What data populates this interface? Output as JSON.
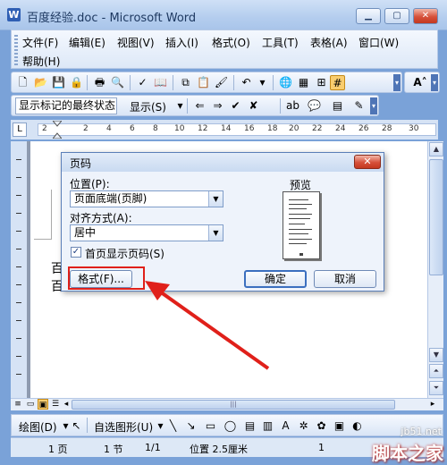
{
  "window": {
    "title": "百度经验.doc - Microsoft Word",
    "buttons": {
      "minimize": "▁",
      "maximize": "▢",
      "close": "✕"
    }
  },
  "menu": {
    "row1": [
      "文件(F)",
      "编辑(E)",
      "视图(V)",
      "插入(I)",
      "格式(O)",
      "工具(T)",
      "表格(A)",
      "窗口(W)"
    ],
    "row2": [
      "帮助(H)"
    ]
  },
  "toolbar_reviewing": {
    "display_combo": "显示标记的最终状态",
    "display_menu": "显示(S)"
  },
  "ruler": {
    "numbers": [
      "2",
      "2",
      "4",
      "6",
      "8",
      "10",
      "12",
      "14",
      "16",
      "18",
      "20",
      "22",
      "24",
      "26",
      "28",
      "30"
    ]
  },
  "document": {
    "visible_chars": [
      "百",
      "百"
    ]
  },
  "dialog": {
    "title": "页码",
    "close": "✕",
    "position_label": "位置(P):",
    "position_value": "页面底端(页脚)",
    "alignment_label": "对齐方式(A):",
    "alignment_value": "居中",
    "first_page_checkbox_label": "首页显示页码(S)",
    "first_page_checked": true,
    "preview_label": "预览",
    "format_button": "格式(F)...",
    "ok_button": "确定",
    "cancel_button": "取消"
  },
  "drawing_toolbar": {
    "draw_menu": "绘图(D)",
    "autoshapes_menu": "自选图形(U)"
  },
  "statusbar": {
    "page": "1 页",
    "section": "1 节",
    "page_of": "1/1",
    "position": "位置 2.5厘米",
    "right_value": "1"
  },
  "watermark": {
    "site": "jb51.net",
    "brand": "脚本之家"
  },
  "colors": {
    "annotation_red": "#e0201a",
    "title_blue": "#1e3961"
  }
}
